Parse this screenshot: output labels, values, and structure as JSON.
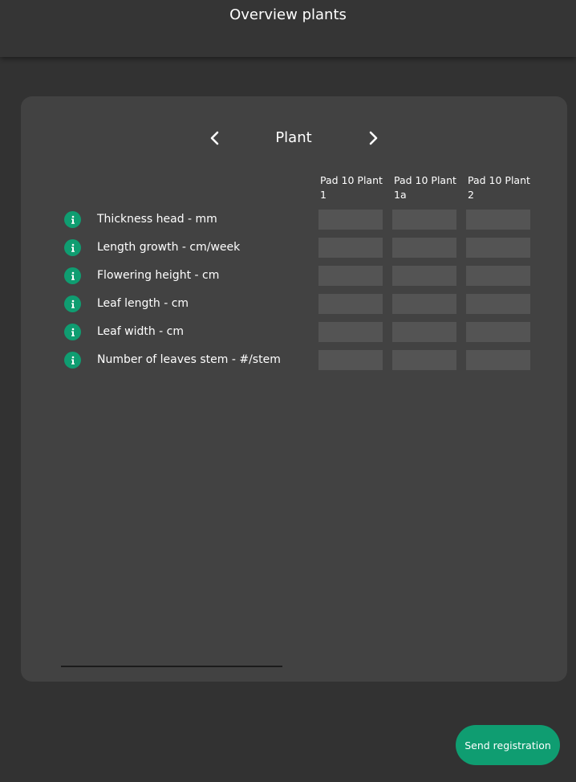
{
  "header": {
    "title": "Overview plants"
  },
  "nav": {
    "title": "Plant",
    "prev_icon": "chevron-left-icon",
    "next_icon": "chevron-right-icon"
  },
  "columns": [
    {
      "label": "Pad 10 Plant 1"
    },
    {
      "label": "Pad 10 Plant 1a"
    },
    {
      "label": "Pad 10 Plant 2"
    }
  ],
  "rows": [
    {
      "label": "Thickness head - mm",
      "values": [
        "",
        "",
        ""
      ]
    },
    {
      "label": "Length growth - cm/week",
      "values": [
        "",
        "",
        ""
      ]
    },
    {
      "label": "Flowering height - cm",
      "values": [
        "",
        "",
        ""
      ]
    },
    {
      "label": "Leaf length - cm",
      "values": [
        "",
        "",
        ""
      ]
    },
    {
      "label": "Leaf width - cm",
      "values": [
        "",
        "",
        ""
      ]
    },
    {
      "label": "Number of leaves stem - #/stem",
      "values": [
        "",
        "",
        ""
      ]
    }
  ],
  "actions": {
    "send_label": "Send registration"
  },
  "colors": {
    "accent": "#0f9d71",
    "background": "#323232",
    "card": "#424242",
    "input": "#545454"
  }
}
